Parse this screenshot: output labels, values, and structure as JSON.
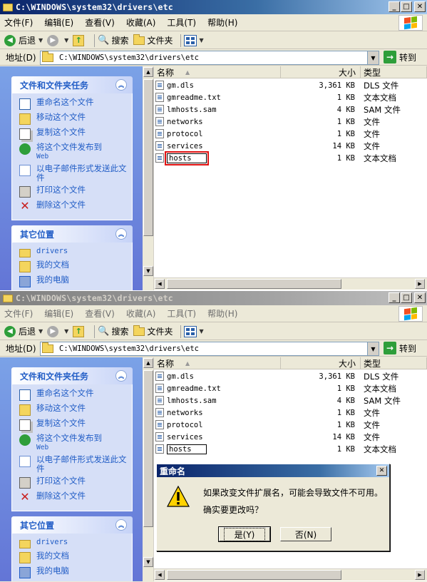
{
  "window": {
    "title": "C:\\WINDOWS\\system32\\drivers\\etc",
    "min_glyph": "_",
    "max_glyph": "□",
    "close_glyph": "✕"
  },
  "menu": [
    "文件(F)",
    "编辑(E)",
    "查看(V)",
    "收藏(A)",
    "工具(T)",
    "帮助(H)"
  ],
  "toolbar": {
    "back": "后退",
    "search": "搜索",
    "folders": "文件夹"
  },
  "address": {
    "label": "地址(D)",
    "value": "C:\\WINDOWS\\system32\\drivers\\etc",
    "go": "转到"
  },
  "tasks": {
    "header": "文件和文件夹任务",
    "items": [
      {
        "icon": "rename-icon",
        "label": "重命名这个文件"
      },
      {
        "icon": "move-icon",
        "label": "移动这个文件"
      },
      {
        "icon": "copy-icon",
        "label": "复制这个文件"
      },
      {
        "icon": "publish-web-icon",
        "label": "将这个文件发布到",
        "sub": "Web"
      },
      {
        "icon": "email-icon",
        "label": "以电子邮件形式发送此文件"
      },
      {
        "icon": "print-icon",
        "label": "打印这个文件"
      },
      {
        "icon": "delete-icon",
        "label": "删除这个文件"
      }
    ]
  },
  "places": {
    "header": "其它位置",
    "items": [
      {
        "icon": "folder-icon",
        "label": "drivers"
      },
      {
        "icon": "my-documents-icon",
        "label": "我的文档"
      },
      {
        "icon": "my-computer-icon",
        "label": "我的电脑"
      }
    ]
  },
  "columns": {
    "name": "名称",
    "size": "大小",
    "type": "类型"
  },
  "files": [
    {
      "name": "gm.dls",
      "size": "3,361 KB",
      "type": "DLS 文件"
    },
    {
      "name": "gmreadme.txt",
      "size": "1 KB",
      "type": "文本文档"
    },
    {
      "name": "lmhosts.sam",
      "size": "4 KB",
      "type": "SAM 文件"
    },
    {
      "name": "networks",
      "size": "1 KB",
      "type": "文件"
    },
    {
      "name": "protocol",
      "size": "1 KB",
      "type": "文件"
    },
    {
      "name": "services",
      "size": "14 KB",
      "type": "文件"
    },
    {
      "name": "hosts",
      "size": "1 KB",
      "type": "文本文档"
    }
  ],
  "dialog": {
    "title": "重命名",
    "message1": "如果改变文件扩展名，可能会导致文件不可用。",
    "message2": "确实要更改吗？",
    "yes": "是(Y)",
    "no": "否(N)",
    "close_glyph": "✕"
  },
  "colors": {
    "highlight": "#e01010",
    "taskpane_top": "#7ba2e7",
    "taskpane_bottom": "#6375d6",
    "link": "#215dc6"
  }
}
